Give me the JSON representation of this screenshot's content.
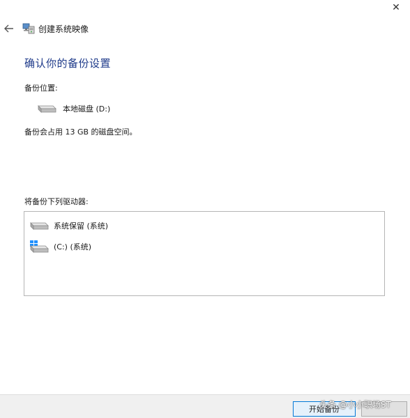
{
  "window": {
    "close_glyph": "✕",
    "title": "创建系统映像"
  },
  "main": {
    "heading": "确认你的备份设置",
    "location_label": "备份位置:",
    "location_value": "本地磁盘 (D:)",
    "space_note": "备份会占用 13 GB 的磁盘空间。",
    "drives_label": "将备份下列驱动器:",
    "drives": [
      {
        "label": "系统保留 (系统)",
        "icon": "hard-drive-icon"
      },
      {
        "label": "(C:) (系统)",
        "icon": "windows-drive-icon"
      }
    ]
  },
  "footer": {
    "start_label": "开始备份",
    "watermark": "头条 @小小职场ST"
  },
  "colors": {
    "heading": "#1e3a8a",
    "accent": "#0078d7",
    "windows_logo": "#1e90ff"
  }
}
